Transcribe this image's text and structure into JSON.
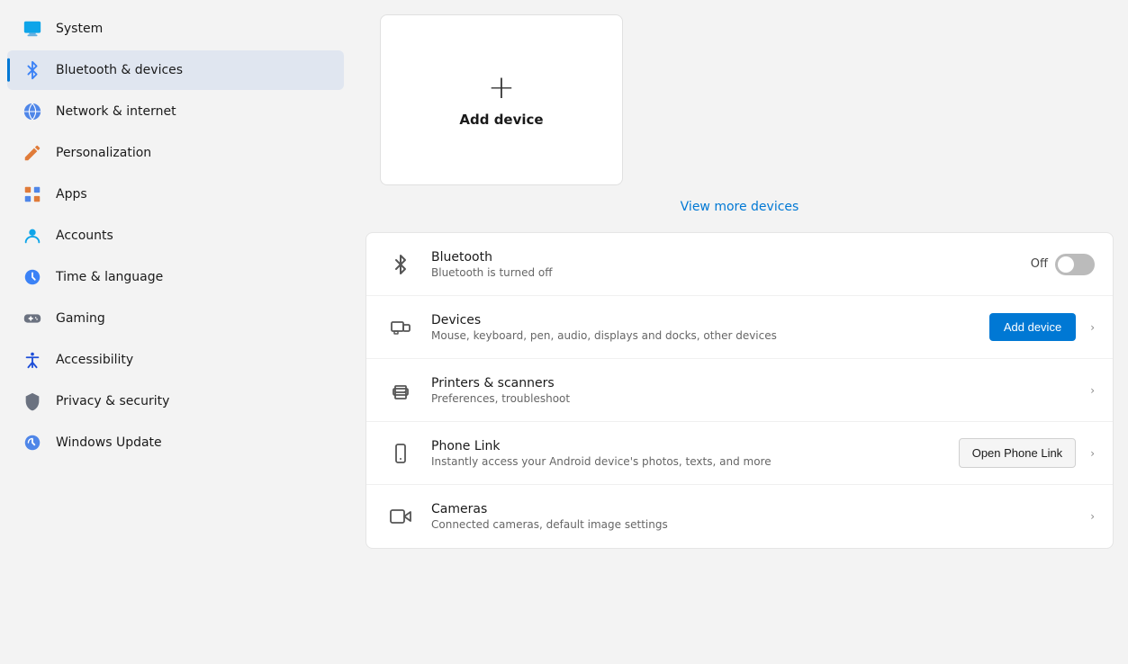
{
  "sidebar": {
    "items": [
      {
        "id": "system",
        "label": "System",
        "icon": "🖥️",
        "active": false
      },
      {
        "id": "bluetooth",
        "label": "Bluetooth & devices",
        "icon": "📶",
        "active": true
      },
      {
        "id": "network",
        "label": "Network & internet",
        "icon": "🌐",
        "active": false
      },
      {
        "id": "personalization",
        "label": "Personalization",
        "icon": "✏️",
        "active": false
      },
      {
        "id": "apps",
        "label": "Apps",
        "icon": "📊",
        "active": false
      },
      {
        "id": "accounts",
        "label": "Accounts",
        "icon": "👤",
        "active": false
      },
      {
        "id": "time",
        "label": "Time & language",
        "icon": "🌍",
        "active": false
      },
      {
        "id": "gaming",
        "label": "Gaming",
        "icon": "🎮",
        "active": false
      },
      {
        "id": "accessibility",
        "label": "Accessibility",
        "icon": "♿",
        "active": false
      },
      {
        "id": "privacy",
        "label": "Privacy & security",
        "icon": "🛡️",
        "active": false
      },
      {
        "id": "update",
        "label": "Windows Update",
        "icon": "🔄",
        "active": false
      }
    ]
  },
  "main": {
    "add_device_card": {
      "plus_icon": "+",
      "label": "Add device"
    },
    "view_more_link": "View more devices",
    "rows": [
      {
        "id": "bluetooth",
        "title": "Bluetooth",
        "subtitle": "Bluetooth is turned off",
        "icon_type": "bluetooth",
        "action_type": "toggle",
        "toggle_state": "off",
        "toggle_label": "Off"
      },
      {
        "id": "devices",
        "title": "Devices",
        "subtitle": "Mouse, keyboard, pen, audio, displays and docks, other devices",
        "icon_type": "devices",
        "action_type": "button-add",
        "button_label": "Add device"
      },
      {
        "id": "printers",
        "title": "Printers & scanners",
        "subtitle": "Preferences, troubleshoot",
        "icon_type": "printer",
        "action_type": "chevron"
      },
      {
        "id": "phone-link",
        "title": "Phone Link",
        "subtitle": "Instantly access your Android device's photos, texts, and more",
        "icon_type": "phone",
        "action_type": "button-phone",
        "button_label": "Open Phone Link"
      },
      {
        "id": "cameras",
        "title": "Cameras",
        "subtitle": "Connected cameras, default image settings",
        "icon_type": "camera",
        "action_type": "chevron"
      }
    ]
  }
}
